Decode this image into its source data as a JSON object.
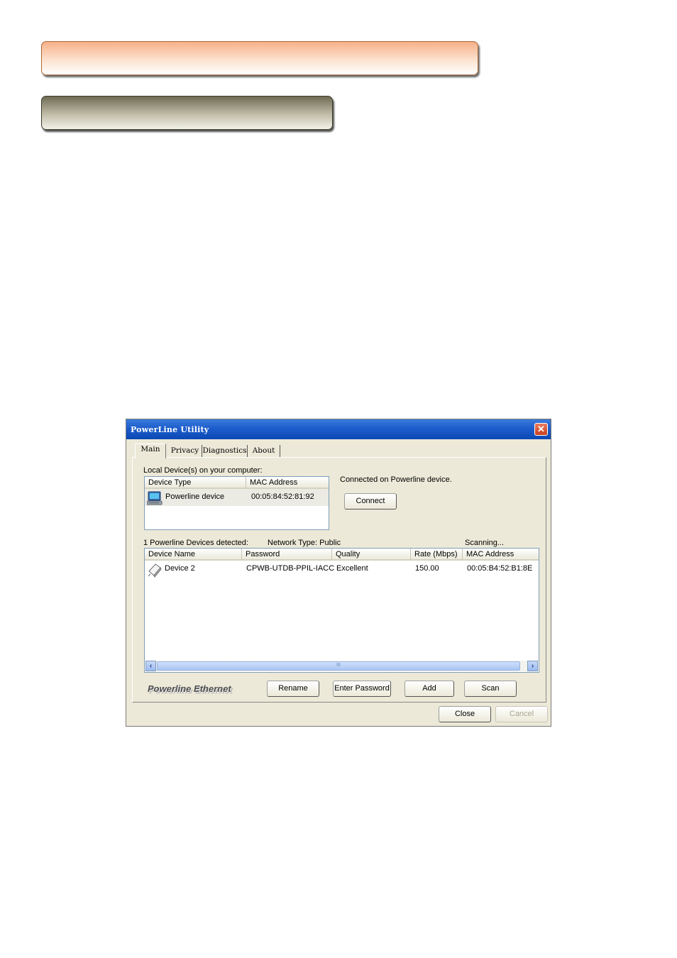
{
  "window": {
    "title": "PowerLine Utility",
    "close_label": "✕"
  },
  "tabs": [
    {
      "label": "Main"
    },
    {
      "label": "Privacy"
    },
    {
      "label": "Diagnostics"
    },
    {
      "label": "About"
    }
  ],
  "local": {
    "label": "Local Device(s) on your computer:",
    "columns": [
      "Device Type",
      "MAC Address"
    ],
    "rows": [
      {
        "device_type": "Powerline device",
        "mac": "00:05:84:52:81:92",
        "icon": "computer-monitor-icon"
      }
    ],
    "status": "Connected on Powerline device.",
    "connect_label": "Connect"
  },
  "remote": {
    "detected": "1 Powerline Devices detected:",
    "network_type": "Network Type: Public",
    "scanning": "Scanning...",
    "columns": [
      "Device Name",
      "Password",
      "Quality",
      "Rate (Mbps)",
      "MAC Address"
    ],
    "rows": [
      {
        "name": "Device 2",
        "password": "CPWB-UTDB-PPIL-IACC",
        "quality": "Excellent",
        "rate": "150.00",
        "mac": "00:05:B4:52:B1:8E",
        "icon": "powerline-adapter-icon"
      }
    ],
    "scroll_grip": "III"
  },
  "brand": "Powerline Ethernet",
  "actions": {
    "rename": "Rename",
    "enter_password": "Enter Password",
    "add": "Add",
    "scan": "Scan"
  },
  "footer": {
    "close": "Close",
    "cancel": "Cancel"
  },
  "colors": {
    "banner_top": "#f7b089",
    "banner_second": "#6f6a53",
    "titlebar": "#1f5fce",
    "window_bg": "#ece9d8",
    "scrollbar": "#a9c5f3"
  }
}
